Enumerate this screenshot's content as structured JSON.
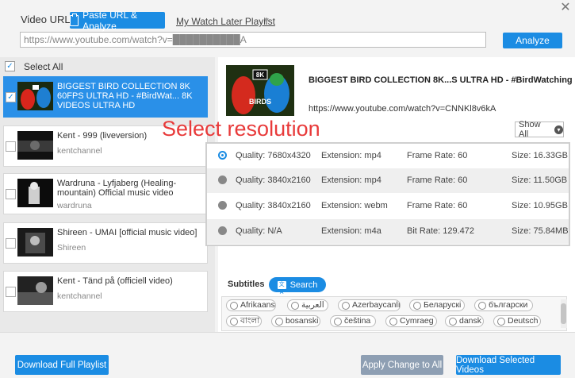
{
  "window": {
    "close_label": "✕"
  },
  "header": {
    "video_url_label": "Video URL:",
    "paste_button_label": "Paste URL & Analyze",
    "playlist_link_label": "My Watch Later Playlist",
    "playlist_caret": "▼",
    "url_value": "https://www.youtube.com/watch?v=██████████A",
    "analyze_label": "Analyze"
  },
  "list": {
    "select_all_label": "Select All",
    "select_all_check": "✓",
    "videos": [
      {
        "title": "BIGGEST BIRD COLLECTION 8K 60FPS ULTRA HD - #BirdWat... 8K VIDEOS ULTRA HD",
        "channel": "",
        "checked": true,
        "check_mark": "✓"
      },
      {
        "title": "Kent - 999 (liveversion)",
        "channel": "kentchannel",
        "checked": false,
        "check_mark": ""
      },
      {
        "title": "Wardruna - Lyfjaberg (Healing-mountain) Official music video",
        "channel": "wardruna",
        "checked": false,
        "check_mark": ""
      },
      {
        "title": "Shireen - UMAI [official music video]",
        "channel": "Shireen",
        "checked": false,
        "check_mark": ""
      },
      {
        "title": "Kent - Tänd på (officiell video)",
        "channel": "kentchannel",
        "checked": false,
        "check_mark": ""
      }
    ]
  },
  "detail": {
    "thumb_badge": "8K",
    "thumb_text": "BIRDS",
    "title": "BIGGEST BIRD COLLECTION 8K...S ULTRA HD - #BirdWatching",
    "url": "https://www.youtube.com/watch?v=CNNKl8v6kA",
    "show_all_label": "Show All",
    "show_all_caret": "▾",
    "annotation": "Select resolution"
  },
  "resolutions": [
    {
      "quality": "Quality: 7680x4320",
      "extension": "Extension: mp4",
      "rate": "Frame Rate: 60",
      "size": "Size: 16.33GB",
      "selected": true
    },
    {
      "quality": "Quality: 3840x2160",
      "extension": "Extension: mp4",
      "rate": "Frame Rate: 60",
      "size": "Size: 11.50GB",
      "selected": false
    },
    {
      "quality": "Quality: 3840x2160",
      "extension": "Extension: webm",
      "rate": "Frame Rate: 60",
      "size": "Size: 10.95GB",
      "selected": false
    },
    {
      "quality": "Quality: N/A",
      "extension": "Extension: m4a",
      "rate": "Bit Rate: 129.472",
      "size": "Size: 75.84MB",
      "selected": false
    }
  ],
  "subtitles": {
    "label": "Subtitles",
    "search_label": "Search",
    "search_icon": "文A",
    "languages": [
      "Afrikaans",
      "العربية",
      "Azerbaycanlı",
      "Беларускі",
      "български",
      "বাংলা",
      "bosanski",
      "čeština",
      "Cymraeg",
      "dansk",
      "Deutsch"
    ]
  },
  "footer": {
    "download_playlist_label": "Download Full Playlist",
    "apply_label": "Apply Change to All",
    "download_selected_label": "Download Selected Videos"
  },
  "colors": {
    "accent": "#1b8ce3",
    "selected_card": "#2a90e8",
    "annotation": "#e83a3a",
    "apply_button": "#8e9fb3"
  }
}
